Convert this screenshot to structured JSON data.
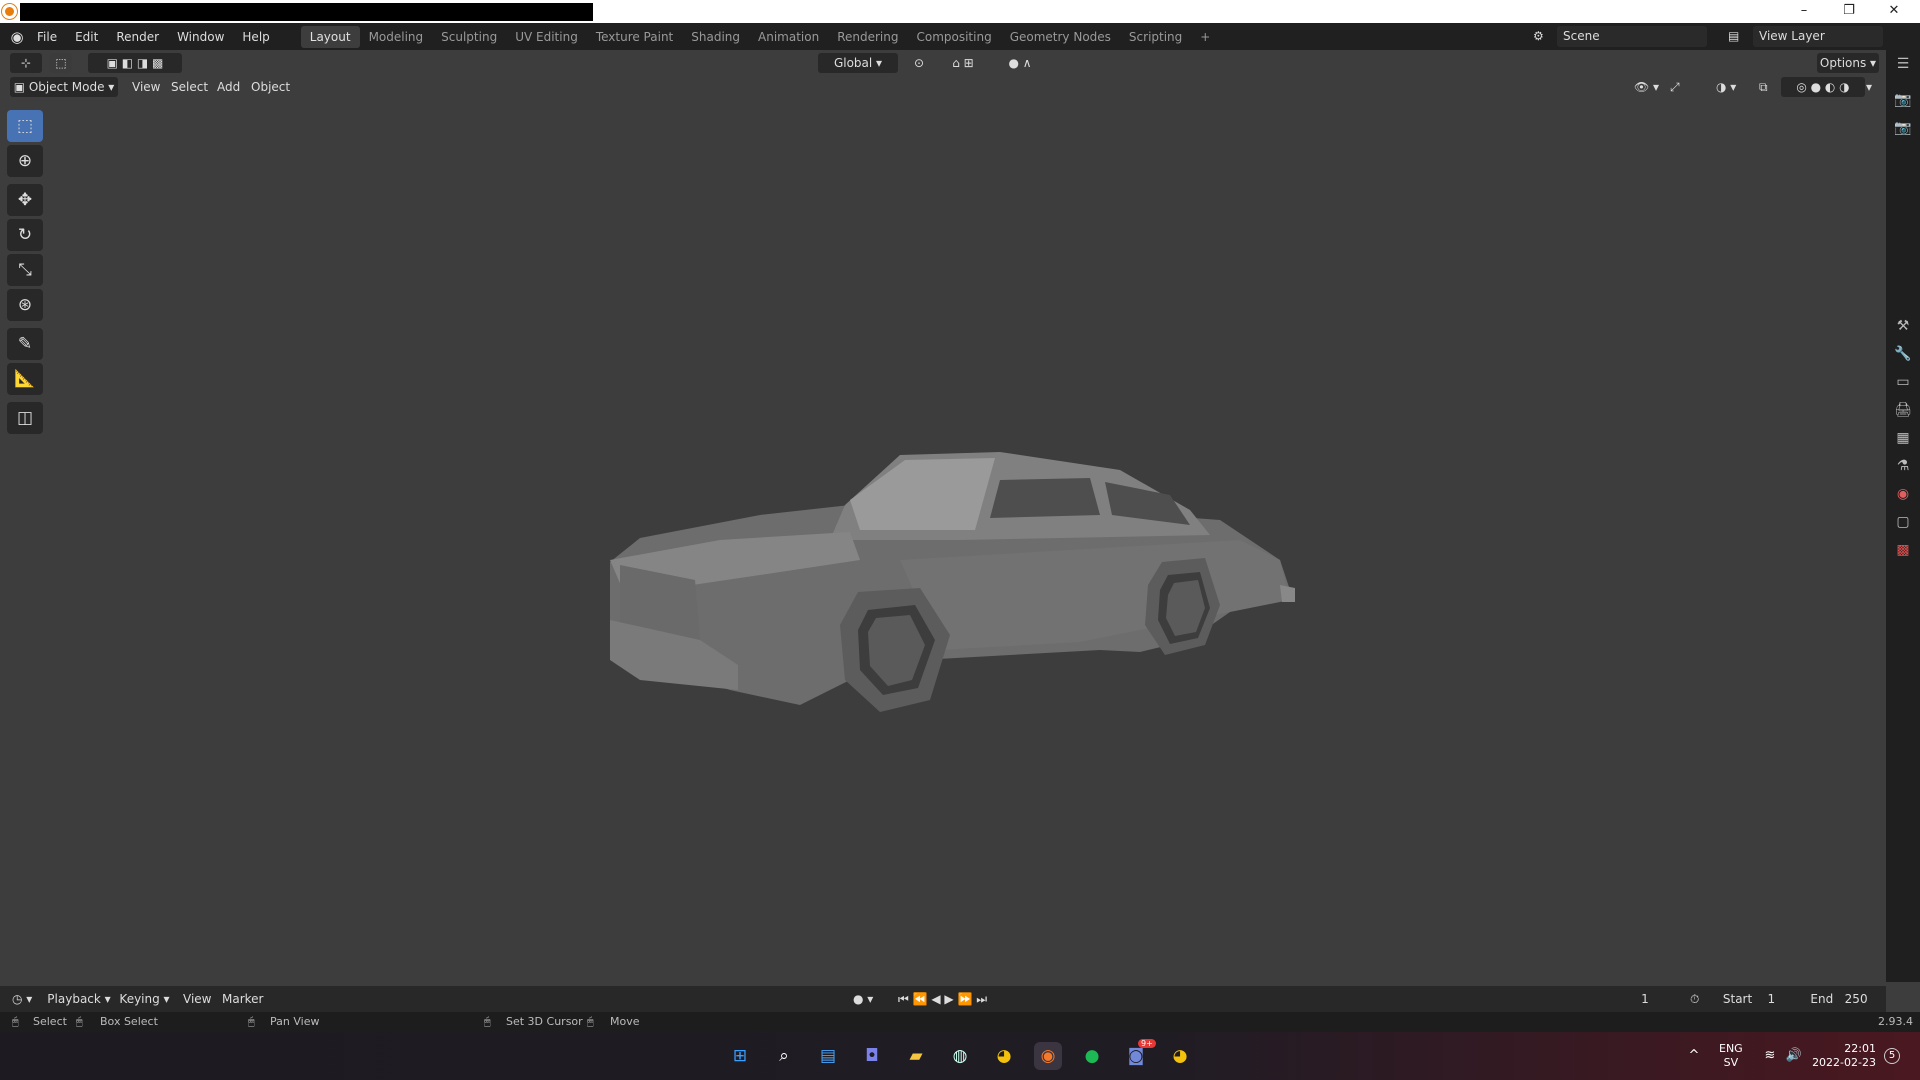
{
  "window": {
    "minimize": "–",
    "maximize": "❐",
    "close": "✕"
  },
  "menus": [
    "File",
    "Edit",
    "Render",
    "Window",
    "Help"
  ],
  "workspaces": [
    "Layout",
    "Modeling",
    "Sculpting",
    "UV Editing",
    "Texture Paint",
    "Shading",
    "Animation",
    "Rendering",
    "Compositing",
    "Geometry Nodes",
    "Scripting",
    "+"
  ],
  "scene": {
    "name": "Scene",
    "view_layer": "View Layer"
  },
  "header": {
    "transform": "Global",
    "options": "Options"
  },
  "viewport_header": {
    "mode": "Object Mode",
    "view": "View",
    "select": "Select",
    "add": "Add",
    "object": "Object"
  },
  "timeline": {
    "playback": "Playback",
    "keying": "Keying",
    "view": "View",
    "marker": "Marker",
    "frame": "1",
    "start_label": "Start",
    "start": "1",
    "end_label": "End",
    "end": "250"
  },
  "status": {
    "select": "Select",
    "box_select": "Box Select",
    "pan": "Pan View",
    "cursor": "Set 3D Cursor",
    "move": "Move",
    "version": "2.93.4"
  },
  "tray": {
    "lang1": "ENG",
    "lang2": "SV",
    "time": "22:01",
    "date": "2022-02-23",
    "badge": "5",
    "discord_badge": "9+"
  },
  "icons": {
    "select": "cursor-box-icon",
    "cursor": "3d-cursor-icon",
    "move": "move-icon",
    "rotate": "rotate-icon",
    "scale": "scale-icon",
    "transform": "transform-icon",
    "annotate": "annotate-icon",
    "measure": "measure-icon",
    "add_cube": "add-cube-icon"
  }
}
